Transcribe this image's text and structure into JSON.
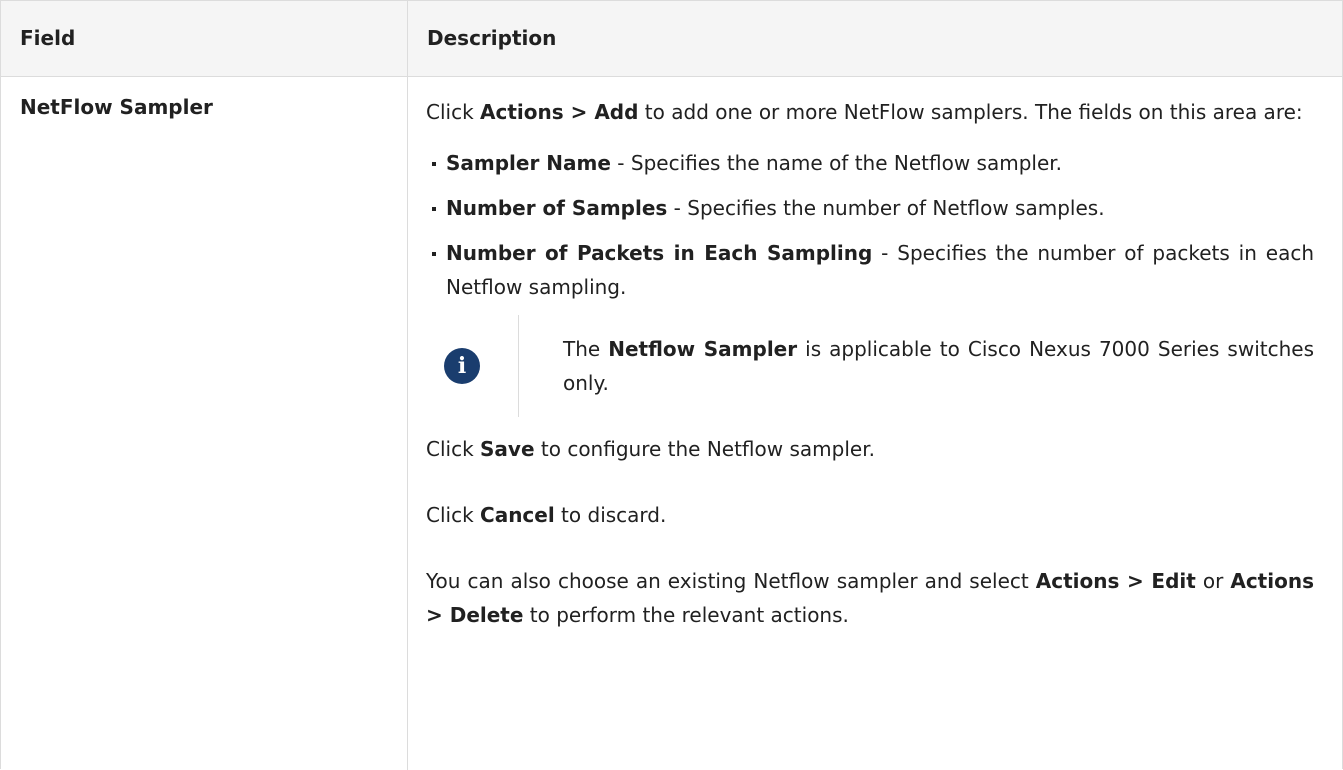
{
  "table": {
    "headers": {
      "field": "Field",
      "description": "Description"
    },
    "row": {
      "field": "NetFlow Sampler",
      "intro": {
        "t1": "Click ",
        "b1": "Actions > Add",
        "t2": " to add one or more NetFlow samplers. The fields on this area are:"
      },
      "bullets": [
        {
          "term": "Sampler Name",
          "text": " - Specifies the name of the Netflow sampler."
        },
        {
          "term": "Number of Samples",
          "text": " - Specifies the number of Netflow samples."
        },
        {
          "term": "Number of Packets in Each Sampling",
          "text": " - Specifies the number of packets in each Netflow sampling."
        }
      ],
      "note": {
        "icon": "info-icon",
        "icon_glyph": "i",
        "t1": "The ",
        "b1": "Netflow Sampler",
        "t2": " is applicable to Cisco Nexus 7000 Series switches only."
      },
      "save": {
        "t1": "Click ",
        "b1": "Save",
        "t2": " to configure the Netflow sampler."
      },
      "cancel": {
        "t1": "Click ",
        "b1": "Cancel",
        "t2": " to discard."
      },
      "edit": {
        "t1": "You can also choose an existing Netflow sampler and select ",
        "b1": "Actions > Edit",
        "t2": " or ",
        "b2": "Actions > Delete",
        "t3": " to perform the relevant actions."
      }
    }
  },
  "colors": {
    "header_bg": "#f5f5f5",
    "border": "#dcdcdc",
    "icon_bg": "#1a3d6e",
    "text": "#212121"
  }
}
